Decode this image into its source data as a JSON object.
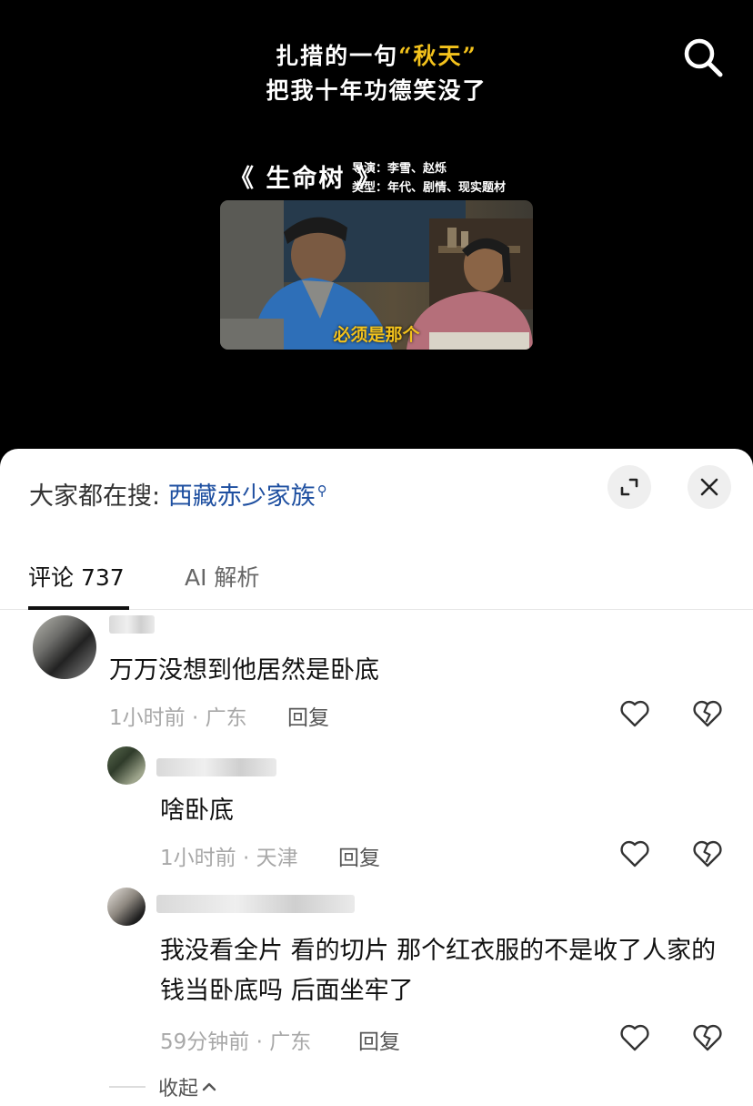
{
  "video": {
    "title_line1_prefix": "扎措的一句",
    "title_line1_open_quote": "“",
    "title_line1_highlight": "秋天",
    "title_line1_close_quote": "”",
    "title_line2": "把我十年功德笑没了",
    "movie_name": "《 生命树 》",
    "movie_director": "导演：李雪、赵烁",
    "movie_genre": "类型：年代、剧情、现实题材",
    "still_subtitle": "必须是那个",
    "highlight_color": "#f3c21c"
  },
  "hot_search": {
    "label": "大家都在搜:",
    "keyword": "西藏赤少家族",
    "keyword_color": "#1e4fa0"
  },
  "tabs": {
    "comments_label": "评论 737",
    "ai_label": "AI 解析"
  },
  "comments": [
    {
      "text": "万万没想到他居然是卧底",
      "meta": "1小时前 · 广东",
      "reply_label": "回复"
    },
    {
      "text": "啥卧底",
      "meta": "1小时前 · 天津",
      "reply_label": "回复"
    },
    {
      "text": "我没看全片 看的切片 那个红衣服的不是收了人家的钱当卧底吗 后面坐牢了",
      "meta": "59分钟前 · 广东",
      "reply_label": "回复"
    }
  ],
  "collapse_label": "收起",
  "icons": [
    "search-icon",
    "expand-icon",
    "close-icon",
    "heart-icon",
    "broken-heart-icon",
    "chevron-up-icon"
  ]
}
